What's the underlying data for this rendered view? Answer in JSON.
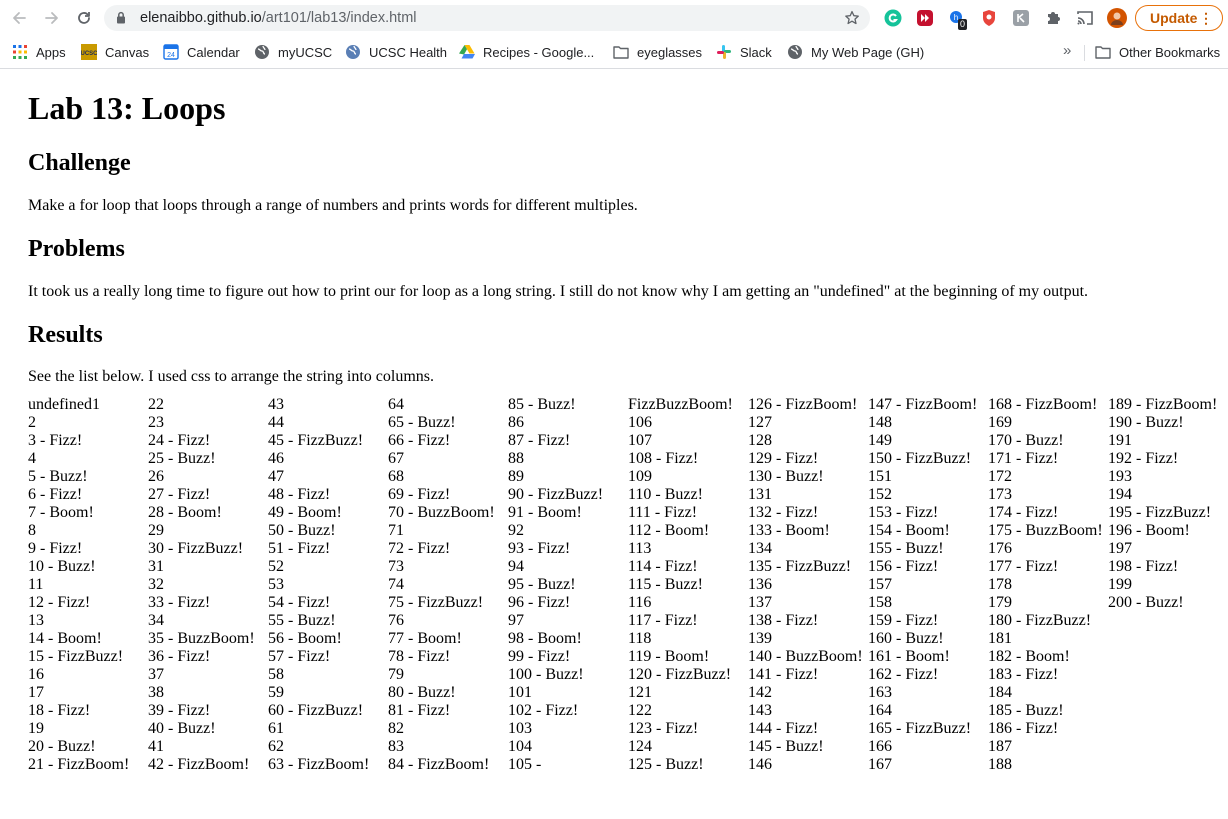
{
  "browser": {
    "url_host": "elenaibbo.github.io",
    "url_path": "/art101/lab13/index.html",
    "update_label": "Update",
    "ext_badge": "0",
    "bookmarks": [
      {
        "label": "Apps",
        "icon": "apps-grid-icon"
      },
      {
        "label": "Canvas",
        "icon": "ucsc-icon"
      },
      {
        "label": "Calendar",
        "icon": "calendar-icon"
      },
      {
        "label": "myUCSC",
        "icon": "globe-icon"
      },
      {
        "label": "UCSC Health",
        "icon": "globe-icon"
      },
      {
        "label": "Recipes - Google...",
        "icon": "drive-icon"
      },
      {
        "label": "eyeglasses",
        "icon": "folder-icon"
      },
      {
        "label": "Slack",
        "icon": "slack-icon"
      },
      {
        "label": "My Web Page (GH)",
        "icon": "globe-icon"
      }
    ],
    "overflow_label": "»",
    "other_bookmarks": "Other Bookmarks"
  },
  "page": {
    "title": "Lab 13: Loops",
    "challenge_heading": "Challenge",
    "challenge_text": "Make a for loop that loops through a range of numbers and prints words for different multiples.",
    "problems_heading": "Problems",
    "problems_text": "It took us a really long time to figure out how to print our for loop as a long string. I still do not know why I am getting an \"undefined\" at the beginning of my output.",
    "results_heading": "Results",
    "results_text": "See the list below. I used css to arrange the string into columns.",
    "results_prefix": "undefined",
    "results": [
      "1",
      "2",
      "3 - Fizz!",
      "4",
      "5 - Buzz!",
      "6 - Fizz!",
      "7 - Boom!",
      "8",
      "9 - Fizz!",
      "10 - Buzz!",
      "11",
      "12 - Fizz!",
      "13",
      "14 - Boom!",
      "15 - FizzBuzz!",
      "16",
      "17",
      "18 - Fizz!",
      "19",
      "20 - Buzz!",
      "21 - FizzBoom!",
      "22",
      "23",
      "24 - Fizz!",
      "25 - Buzz!",
      "26",
      "27 - Fizz!",
      "28 - Boom!",
      "29",
      "30 - FizzBuzz!",
      "31",
      "32",
      "33 - Fizz!",
      "34",
      "35 - BuzzBoom!",
      "36 - Fizz!",
      "37",
      "38",
      "39 - Fizz!",
      "40 - Buzz!",
      "41",
      "42 - FizzBoom!",
      "43",
      "44",
      "45 - FizzBuzz!",
      "46",
      "47",
      "48 - Fizz!",
      "49 - Boom!",
      "50 - Buzz!",
      "51 - Fizz!",
      "52",
      "53",
      "54 - Fizz!",
      "55 - Buzz!",
      "56 - Boom!",
      "57 - Fizz!",
      "58",
      "59",
      "60 - FizzBuzz!",
      "61",
      "62",
      "63 - FizzBoom!",
      "64",
      "65 - Buzz!",
      "66 - Fizz!",
      "67",
      "68",
      "69 - Fizz!",
      "70 - BuzzBoom!",
      "71",
      "72 - Fizz!",
      "73",
      "74",
      "75 - FizzBuzz!",
      "76",
      "77 - Boom!",
      "78 - Fizz!",
      "79",
      "80 - Buzz!",
      "81 - Fizz!",
      "82",
      "83",
      "84 - FizzBoom!",
      "85 - Buzz!",
      "86",
      "87 - Fizz!",
      "88",
      "89",
      "90 - FizzBuzz!",
      "91 - Boom!",
      "92",
      "93 - Fizz!",
      "94",
      "95 - Buzz!",
      "96 - Fizz!",
      "97",
      "98 - Boom!",
      "99 - Fizz!",
      "100 - Buzz!",
      "101",
      "102 - Fizz!",
      "103",
      "104",
      "105 - FizzBuzzBoom!",
      "106",
      "107",
      "108 - Fizz!",
      "109",
      "110 - Buzz!",
      "111 - Fizz!",
      "112 - Boom!",
      "113",
      "114 - Fizz!",
      "115 - Buzz!",
      "116",
      "117 - Fizz!",
      "118",
      "119 - Boom!",
      "120 - FizzBuzz!",
      "121",
      "122",
      "123 - Fizz!",
      "124",
      "125 - Buzz!",
      "126 - FizzBoom!",
      "127",
      "128",
      "129 - Fizz!",
      "130 - Buzz!",
      "131",
      "132 - Fizz!",
      "133 - Boom!",
      "134",
      "135 - FizzBuzz!",
      "136",
      "137",
      "138 - Fizz!",
      "139",
      "140 - BuzzBoom!",
      "141 - Fizz!",
      "142",
      "143",
      "144 - Fizz!",
      "145 - Buzz!",
      "146",
      "147 - FizzBoom!",
      "148",
      "149",
      "150 - FizzBuzz!",
      "151",
      "152",
      "153 - Fizz!",
      "154 - Boom!",
      "155 - Buzz!",
      "156 - Fizz!",
      "157",
      "158",
      "159 - Fizz!",
      "160 - Buzz!",
      "161 - Boom!",
      "162 - Fizz!",
      "163",
      "164",
      "165 - FizzBuzz!",
      "166",
      "167",
      "168 - FizzBoom!",
      "169",
      "170 - Buzz!",
      "171 - Fizz!",
      "172",
      "173",
      "174 - Fizz!",
      "175 - BuzzBoom!",
      "176",
      "177 - Fizz!",
      "178",
      "179",
      "180 - FizzBuzz!",
      "181",
      "182 - Boom!",
      "183 - Fizz!",
      "184",
      "185 - Buzz!",
      "186 - Fizz!",
      "187",
      "188",
      "189 - FizzBoom!",
      "190 - Buzz!",
      "191",
      "192 - Fizz!",
      "193",
      "194",
      "195 - FizzBuzz!",
      "196 - Boom!",
      "197",
      "198 - Fizz!",
      "199",
      "200 - Buzz!"
    ]
  }
}
